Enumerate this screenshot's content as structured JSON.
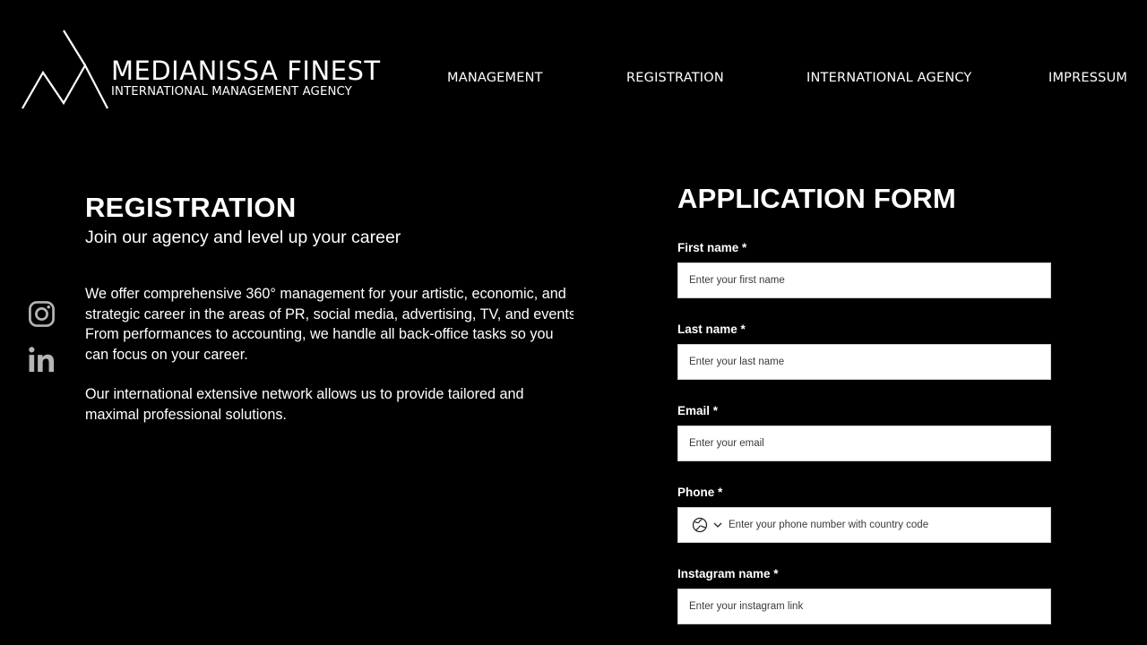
{
  "header": {
    "brand_title": "MEDIANISSA FINEST",
    "brand_subtitle": "INTERNATIONAL MANAGEMENT AGENCY",
    "nav": {
      "management": "MANAGEMENT",
      "registration": "REGISTRATION",
      "international_agency": "INTERNATIONAL AGENCY",
      "impressum": "IMPRESSUM"
    }
  },
  "social": {
    "icons": [
      "instagram-icon",
      "linkedin-icon"
    ]
  },
  "intro": {
    "title": "REGISTRATION",
    "subtitle": "Join our agency and level up your career",
    "paragraph1": {
      "line1": "We offer comprehensive 360° management for your artistic, economic, and",
      "line2": "strategic career in the areas of PR, social media, advertising, TV, and events.",
      "line3": "From performances to accounting, we handle all back-office tasks so you",
      "line4": "can focus on your career."
    },
    "paragraph2": {
      "line1": "Our international extensive network allows us to provide tailored and",
      "line2": "maximal professional solutions."
    }
  },
  "form": {
    "title": "APPLICATION FORM",
    "first_name": {
      "label": "First name *",
      "placeholder": "Enter your first name",
      "value": ""
    },
    "last_name": {
      "label": "Last name *",
      "placeholder": "Enter your last name",
      "value": ""
    },
    "email": {
      "label": "Email *",
      "placeholder": "Enter your email",
      "value": ""
    },
    "phone": {
      "label": "Phone *",
      "placeholder": "Enter your phone number with country code",
      "value": "",
      "country_icon": "globe-icon"
    },
    "instagram": {
      "label": "Instagram name *",
      "placeholder": "Enter your instagram link",
      "value": ""
    }
  },
  "colors": {
    "background": "#000000",
    "text": "#ffffff",
    "input_background": "#ffffff",
    "icon_gray": "#b5b5b5"
  }
}
